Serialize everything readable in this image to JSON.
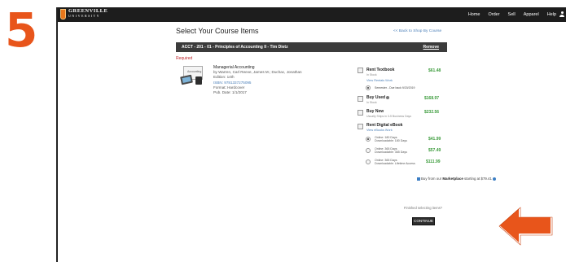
{
  "step_number": "5",
  "header": {
    "logo_title": "GREENVILLE",
    "logo_sub": "UNIVERSITY",
    "nav": [
      "Home",
      "Order",
      "Sell",
      "Apparel",
      "Help"
    ]
  },
  "page": {
    "title": "Select Your Course Items",
    "back_link": "<< Back to Shop By Course"
  },
  "course": {
    "code": "ACCT - 201 - 01  - Principles of Accounting II - Tim Dietz",
    "remove_label": "Remove",
    "required_label": "Required"
  },
  "book": {
    "cover_text": "Accounting",
    "name": "Managerial Accounting",
    "authors": "by Warren, Carl Reeve, James M.; Duchac, Jonathan",
    "edition": "Edition: 14th",
    "isbn": "ISBN: 9781337275095",
    "format": "Format: Hardcover",
    "pub_date": "Pub. Date: 1/1/2017"
  },
  "options": {
    "rent_textbook": {
      "label": "Rent Textbook",
      "sub": "In Stock",
      "price": "$61.48",
      "link": "View Rentals Work",
      "semester": "Semester - Due back 9/20/2019"
    },
    "buy_used": {
      "label": "Buy Used",
      "sub": "In Stock",
      "price": "$168.97"
    },
    "buy_new": {
      "label": "Buy New",
      "sub": "Usually Ships in 3-5 Business Days",
      "price": "$232.56"
    },
    "rent_ebook": {
      "label": "Rent Digital eBook",
      "link": "View eBooks Work"
    },
    "ebook_terms": [
      {
        "line1": "Online: 180 Days",
        "line2": "Downloadable: 180 Days",
        "price": "$41.99"
      },
      {
        "line1": "Online: 365 Days",
        "line2": "Downloadable: 365 Days",
        "price": "$57.49"
      },
      {
        "line1": "Online: 365 Days",
        "line2": "Downloadable: Lifetime Access",
        "price": "$111.99"
      }
    ]
  },
  "marketplace": {
    "pre": "Buy from our",
    "bold": "Marketplace",
    "post": "starting at $79.41"
  },
  "footer": {
    "finished": "Finished selecting items?",
    "continue": "CONTINUE"
  },
  "colors": {
    "accent": "#e8551b",
    "price": "#3a9b3a",
    "link": "#4a7fb8",
    "navbar": "#1d1d1d"
  },
  "icons": [
    "user-icon",
    "info-icon",
    "arrow-icon",
    "logo-shield-icon"
  ]
}
